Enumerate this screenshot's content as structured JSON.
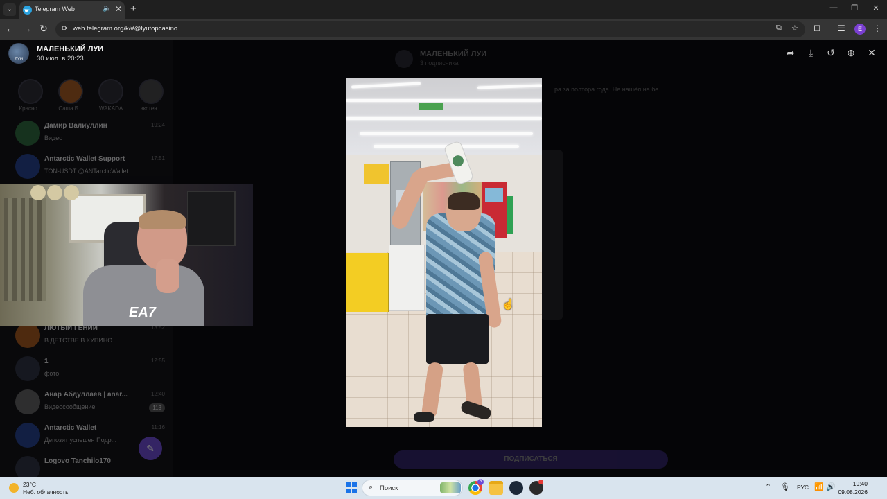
{
  "browser": {
    "tab_title": "Telegram Web",
    "url": "web.telegram.org/k/#@lyutopcasino",
    "new_tab_symbol": "+",
    "profile_initial": "E"
  },
  "viewer": {
    "channel_title": "МАЛЕНЬКИЙ ЛУИ",
    "avatar_caption": "ЛУИ",
    "date": "30 июл. в 20:23"
  },
  "background_chat": {
    "stories": [
      {
        "label": "Красно..."
      },
      {
        "label": "Саша Б..."
      },
      {
        "label": "WAKADA"
      },
      {
        "label": "экстен..."
      }
    ],
    "chats": [
      {
        "name": "Дамир Валиуллин",
        "preview": "Видео",
        "time": "19:24",
        "badge": ""
      },
      {
        "name": "Antarctic Wallet Support",
        "preview": "TON-USDT @ANTarcticWallet",
        "time": "17:51",
        "badge": ""
      },
      {
        "name": "ЛЮТЫЙ ГЕНИЙ",
        "preview": "В ДЕТСТВЕ В КУПИНО",
        "time": "13:52",
        "badge": ""
      },
      {
        "name": "1",
        "preview": "фото",
        "time": "12:55",
        "badge": ""
      },
      {
        "name": "Анар Абдуллаев | anar...",
        "preview": "Видеосообщение",
        "time": "12:40",
        "badge": "113"
      },
      {
        "name": "Antarctic Wallet",
        "preview": "Депозит успешен Подр...",
        "time": "11:16",
        "badge": ""
      },
      {
        "name": "Logovo Tanchilo170",
        "preview": "",
        "time": "",
        "badge": ""
      }
    ],
    "pane_title": "МАЛЕНЬКИЙ ЛУИ",
    "pane_subtitle": "3 подписчика",
    "pinned_text": "ра за полтора года. Не нашёл на бе...",
    "subscribe_label": "ПОДПИСАТЬСЯ"
  },
  "webcam": {
    "shirt_logo": "EA7"
  },
  "taskbar": {
    "temperature": "23°C",
    "weather": "Неб. облачность",
    "search_placeholder": "Поиск",
    "chrome_badge": "6",
    "language": "РУС",
    "time": "19:40",
    "date": "09.08.2026"
  },
  "colors": {
    "telegram_blue": "#2aa3e0",
    "subscribe_purple": "#5b3ec8",
    "taskbar_bg": "#d9e4ee",
    "profile_purple": "#7a3fd1"
  },
  "icons": [
    "tab-menu-icon",
    "telegram-icon",
    "audio-icon",
    "close-icon",
    "back-icon",
    "forward-icon",
    "reload-icon",
    "site-info-icon",
    "install-icon",
    "star-icon",
    "extensions-icon",
    "media-icon",
    "more-icon",
    "forward-share-icon",
    "download-icon",
    "rotate-icon",
    "zoom-icon",
    "viewer-close-icon",
    "hand-cursor-icon",
    "weather-icon",
    "windows-icon",
    "search-icon",
    "chrome-icon",
    "folder-icon",
    "steam-icon",
    "chevron-up-icon",
    "microphone-icon",
    "wifi-icon",
    "volume-icon"
  ]
}
